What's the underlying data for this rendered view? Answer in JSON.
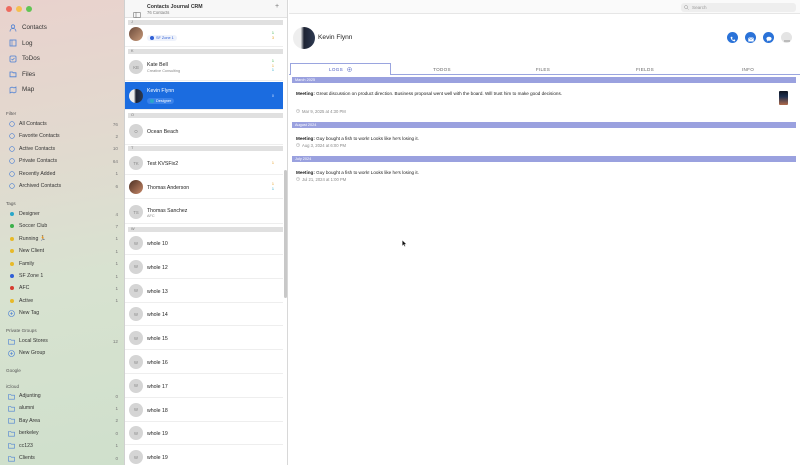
{
  "window": {
    "traffic_colors": [
      "#ee6a5e",
      "#f5bf4f",
      "#61c554"
    ]
  },
  "sidebar": {
    "nav": [
      {
        "label": "Contacts",
        "icon": "person-icon"
      },
      {
        "label": "Log",
        "icon": "book-icon"
      },
      {
        "label": "ToDos",
        "icon": "checklist-icon"
      },
      {
        "label": "Files",
        "icon": "folder-icon"
      },
      {
        "label": "Map",
        "icon": "map-icon"
      }
    ],
    "filter_header": "Filter",
    "filters": [
      {
        "label": "All Contacts",
        "count": "76"
      },
      {
        "label": "Favorite Contacts",
        "count": "2"
      },
      {
        "label": "Active Contacts",
        "count": "10"
      },
      {
        "label": "Private Contacts",
        "count": "64"
      },
      {
        "label": "Recently Added",
        "count": "1"
      },
      {
        "label": "Archived Contacts",
        "count": "6"
      }
    ],
    "tags_header": "Tags",
    "tags": [
      {
        "label": "Designer",
        "count": "4",
        "color": "#2aa7c9"
      },
      {
        "label": "Soccer Club",
        "count": "7",
        "color": "#3bb04a"
      },
      {
        "label": "Running 🏃",
        "count": "1",
        "color": "#e7b928"
      },
      {
        "label": "New Client",
        "count": "1",
        "color": "#e7b928"
      },
      {
        "label": "Family",
        "count": "1",
        "color": "#e7b928"
      },
      {
        "label": "SF Zone 1",
        "count": "1",
        "color": "#2f5fd6"
      },
      {
        "label": "AFC",
        "count": "1",
        "color": "#d63c2f"
      },
      {
        "label": "Active",
        "count": "1",
        "color": "#e7b928"
      }
    ],
    "new_tag": "New Tag",
    "private_header": "Private Groups",
    "private_groups": [
      {
        "label": "Local Stores",
        "count": "12"
      }
    ],
    "new_group": "New Group",
    "google_header": "Google",
    "icloud_header": "iCloud",
    "icloud": [
      {
        "label": "Adjunting",
        "count": "0"
      },
      {
        "label": "alumni",
        "count": "1"
      },
      {
        "label": "Bay Area",
        "count": "2"
      },
      {
        "label": "berkeley",
        "count": "0"
      },
      {
        "label": "cc123",
        "count": "1"
      },
      {
        "label": "Clients",
        "count": "0"
      }
    ]
  },
  "list": {
    "title": "Contacts Journal CRM",
    "subtitle": "76 Contacts",
    "sections": {
      "j": "J",
      "k": "K",
      "o": "O",
      "t": "T",
      "w": "W"
    },
    "top_tag": "SF Zone 1",
    "top_counts": [
      "1",
      "3"
    ],
    "kate": {
      "name": "Kate Bell",
      "company": "Creative Consulting",
      "initials": "KB",
      "counts": [
        "1",
        "1",
        "1"
      ]
    },
    "kevin": {
      "name": "Kevin Flynn",
      "tag": "Designer",
      "count": "0"
    },
    "ocean": {
      "name": "Ocean Beach",
      "initials": "O"
    },
    "test": {
      "name": "Test KVSFix2",
      "initials": "TK",
      "count": "1"
    },
    "thomas_a": {
      "name": "Thomas Anderson",
      "counts": [
        "1",
        "1"
      ]
    },
    "thomas_s": {
      "name": "Thomas Sanchez",
      "company": "AFC",
      "initials": "TS"
    },
    "whole": [
      {
        "name": "whole 10"
      },
      {
        "name": "whole 12"
      },
      {
        "name": "whole 13"
      },
      {
        "name": "whole 14"
      },
      {
        "name": "whole 15"
      },
      {
        "name": "whole 16"
      },
      {
        "name": "whole 17"
      },
      {
        "name": "whole 18"
      },
      {
        "name": "whole 19"
      },
      {
        "name": "whole 19"
      }
    ],
    "whole_initial": "W"
  },
  "detail": {
    "search_placeholder": "Search",
    "name": "Kevin Flynn",
    "tabs": [
      "LOGS",
      "TODOS",
      "FILES",
      "FIELDS",
      "INFO"
    ],
    "months": [
      "March 2025",
      "August 2024",
      "July 2024"
    ],
    "notes": [
      {
        "kind": "Meeting:",
        "text": " Great discussion on product direction. Business proposal went well with the board. Will trust him to make good decisions.",
        "date": "Mar 9, 2025 at 4:30 PM"
      },
      {
        "kind": "Meeting:",
        "text": " Guy bought a fish to work! Looks like he's losing it.",
        "date": "Aug 3, 2024 at 6:00 PM"
      },
      {
        "kind": "Meeting:",
        "text": " Guy bought a fish to work! Looks like he's losing it.",
        "date": "Jul 21, 2024 at 1:00 PM"
      }
    ]
  },
  "colors": {
    "accent": "#1b6ce0",
    "month_bar": "#9aa1df"
  }
}
